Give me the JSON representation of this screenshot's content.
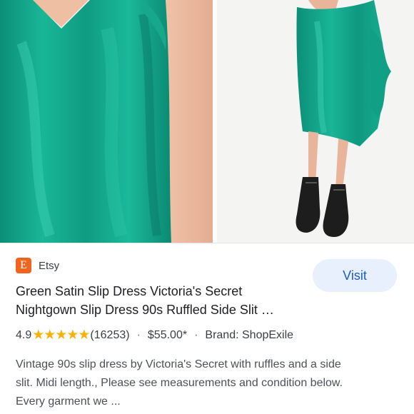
{
  "result": {
    "source": "Etsy",
    "favicon_letter": "E",
    "visit_label": "Visit",
    "title_line1": "Green Satin Slip Dress Victoria's Secret",
    "title_line2": "Nightgown Slip Dress 90s Ruffled Side Slit …",
    "rating": "4.9",
    "stars": "★★★★★",
    "review_count": "(16253)",
    "separator": "·",
    "price": "$55.00*",
    "brand": "Brand: ShopExile",
    "description_line1": "Vintage 90s slip dress by Victoria's Secret with ruffles and a side",
    "description_line2": "slit. Midi length., Please see measurements and condition below.",
    "description_line3": "Every garment we ..."
  },
  "colors": {
    "dress_green": "#12a48a",
    "etsy_orange": "#f1641e",
    "star_gold": "#f6b20b",
    "visit_bg": "#e8f0fe",
    "visit_text": "#1a5dc7"
  }
}
